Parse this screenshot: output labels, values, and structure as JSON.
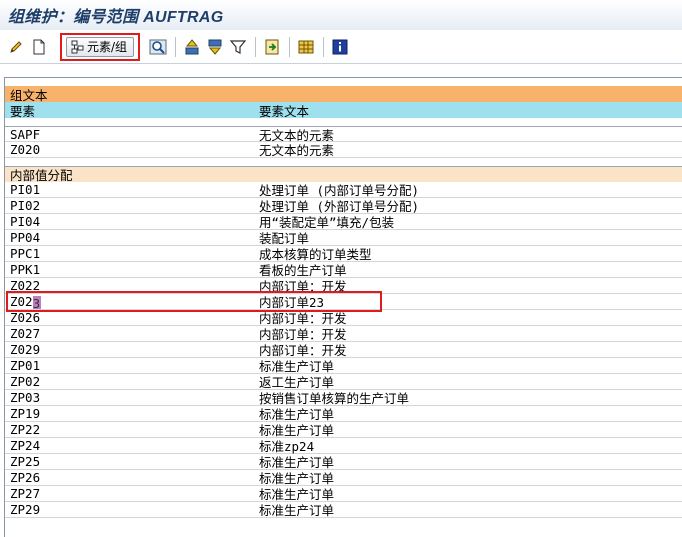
{
  "window": {
    "title": "组维护：编号范围 AUFTRAG"
  },
  "toolbar": {
    "element_group_label": "元素/组",
    "icons": [
      "pencil-icon",
      "new-document-icon",
      "element-group-icon",
      "find-icon",
      "sort-ascending-icon",
      "sort-descending-icon",
      "filter-icon",
      "export-icon",
      "table-layout-icon",
      "info-icon"
    ]
  },
  "group_text": {
    "header": "组文本",
    "col_element": "要素",
    "col_element_text": "要素文本",
    "rows": [
      {
        "code": "SAPF",
        "text": "无文本的元素"
      },
      {
        "code": "Z020",
        "text": "无文本的元素"
      }
    ]
  },
  "internal": {
    "header": "内部值分配",
    "rows": [
      {
        "code": "PI01",
        "text": "处理订单 (内部订单号分配)"
      },
      {
        "code": "PI02",
        "text": "处理订单 (外部订单号分配)"
      },
      {
        "code": "PI04",
        "text": "用“装配定单”填充/包装"
      },
      {
        "code": "PP04",
        "text": "装配订单"
      },
      {
        "code": "PPC1",
        "text": "成本核算的订单类型"
      },
      {
        "code": "PPK1",
        "text": "看板的生产订单"
      },
      {
        "code": "Z022",
        "text": "内部订单：开发"
      },
      {
        "code_prefix": "Z02",
        "code_suffix": "3",
        "text": "内部订单23"
      },
      {
        "code": "Z026",
        "text": "内部订单：开发"
      },
      {
        "code": "Z027",
        "text": "内部订单：开发"
      },
      {
        "code": "Z029",
        "text": "内部订单：开发"
      },
      {
        "code": "ZP01",
        "text": "标准生产订单"
      },
      {
        "code": "ZP02",
        "text": "返工生产订单"
      },
      {
        "code": "ZP03",
        "text": "按销售订单核算的生产订单"
      },
      {
        "code": "ZP19",
        "text": "标准生产订单"
      },
      {
        "code": "ZP22",
        "text": "标准生产订单"
      },
      {
        "code": "ZP24",
        "text": "标准zp24"
      },
      {
        "code": "ZP25",
        "text": "标准生产订单"
      },
      {
        "code": "ZP26",
        "text": "标准生产订单"
      },
      {
        "code": "ZP27",
        "text": "标准生产订单"
      },
      {
        "code": "ZP29",
        "text": "标准生产订单"
      }
    ]
  },
  "colors": {
    "header_orange": "#f7b36b",
    "header_cyan": "#9fe0ef",
    "header_peach": "#fae3c6",
    "highlight_red": "#e01b1b"
  }
}
